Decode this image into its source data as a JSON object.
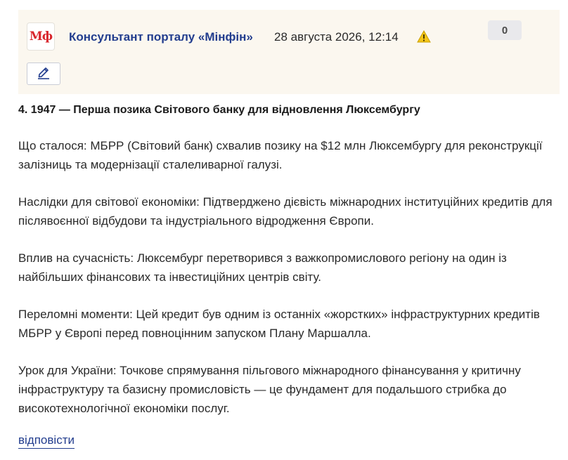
{
  "post": {
    "author_logo_text": "Мф",
    "author": "Консультант порталу «Мінфін»",
    "date": "28 августа 2026, 12:14",
    "score": "0",
    "title": "4. 1947 — Перша позика Світового банку для відновлення Люксембургу",
    "paragraphs": [
      "Що сталося: МБРР (Світовий банк) схвалив позику на $12 млн Люксембургу для реконструкції залізниць та модернізації сталеливарної галузі.",
      "Наслідки для світової економіки: Підтверджено дієвість міжнародних інституційних кредитів для післявоєнної відбудови та індустріального відродження Європи.",
      "Вплив на сучасність: Люксембург перетворився з важкопромислового регіону на один із найбільших фінансових та інвестиційних центрів світу.",
      "Переломні моменти: Цей кредит був одним із останніх «жорстких» інфраструктурних кредитів МБРР у Європі перед повноцінним запуском Плану Маршалла.",
      "Урок для України: Точкове спрямування пільгового міжнародного фінансування у критичну інфраструктуру та базисну промисловість — це фундамент для подальшого стрибка до високотехнологічної економіки послуг."
    ],
    "reply_label": "відповісти"
  },
  "icons": {
    "warning": "warning-icon",
    "edit": "pencil-icon"
  },
  "colors": {
    "header_bg": "#fbf7ef",
    "brand_red": "#d8262d",
    "link_blue": "#223d8e",
    "warning_yellow": "#f5c518"
  }
}
